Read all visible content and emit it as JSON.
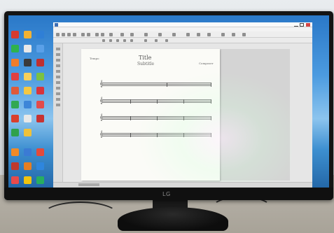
{
  "monitor": {
    "brand_logo": "LG"
  },
  "score": {
    "title": "Title",
    "subtitle": "Subtitle",
    "composer": "Composer",
    "tempo": "Tempo",
    "staves": 4,
    "clef": "𝄞"
  },
  "colors": {
    "desktop_sky": "#4c9be0",
    "app_chrome": "#e6e6e6",
    "page": "#fbfbf7",
    "bezel": "#141414"
  },
  "icons": [
    "program-icon",
    "minimize-icon",
    "maximize-icon",
    "close-icon"
  ]
}
